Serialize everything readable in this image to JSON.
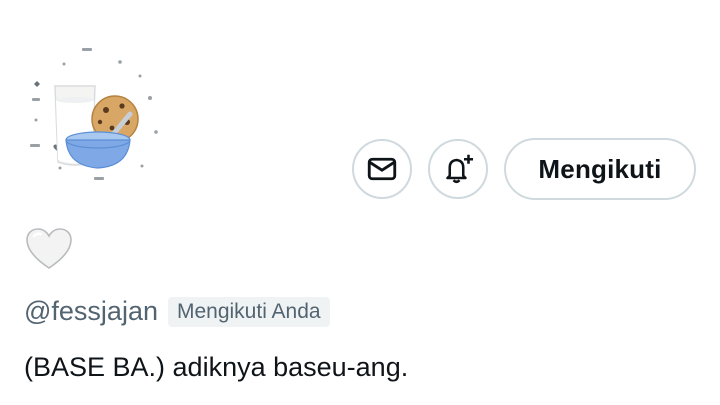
{
  "profile": {
    "display_name_icon": "white-heart-icon",
    "handle": "@fessjajan",
    "follows_you_label": "Mengikuti Anda",
    "bio": "(BASE BA.) adiknya baseu-ang."
  },
  "actions": {
    "message_icon": "envelope-icon",
    "notify_icon": "bell-plus-icon",
    "follow_label": "Mengikuti"
  },
  "colors": {
    "text_primary": "#0f1419",
    "text_secondary": "#536471",
    "border": "#cfd9de",
    "badge_bg": "#eff3f4"
  }
}
